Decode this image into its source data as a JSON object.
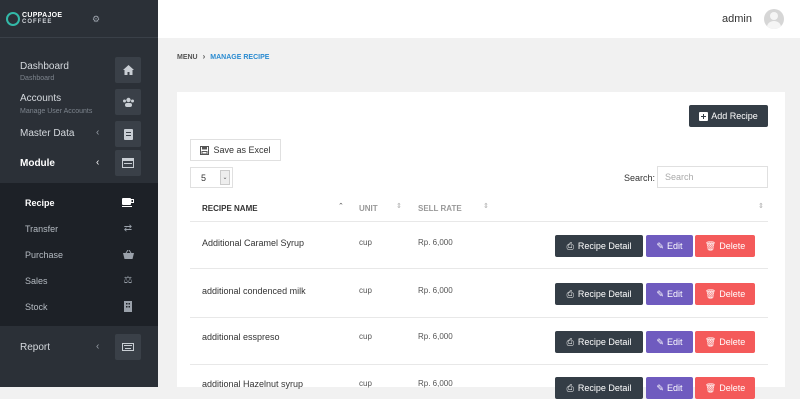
{
  "sidebar": {
    "logo": {
      "name": "CUPPAJOE",
      "sub": "COFFEE"
    },
    "items": [
      {
        "label": "Dashboard",
        "sub": "Dashboard",
        "icon": "home-icon"
      },
      {
        "label": "Accounts",
        "sub": "Manage User Accounts",
        "icon": "users-icon"
      },
      {
        "label": "Master Data",
        "icon": "archive-icon"
      },
      {
        "label": "Module",
        "icon": "window-icon"
      },
      {
        "label": "Report",
        "icon": "keyboard-icon"
      }
    ],
    "module_items": [
      {
        "label": "Recipe",
        "icon": "coffee-icon"
      },
      {
        "label": "Transfer",
        "icon": "exchange-icon"
      },
      {
        "label": "Purchase",
        "icon": "basket-icon"
      },
      {
        "label": "Sales",
        "icon": "balance-scale-icon"
      },
      {
        "label": "Stock",
        "icon": "building-icon"
      }
    ]
  },
  "header": {
    "user": "admin"
  },
  "breadcrumb": {
    "menu": "MENU",
    "separator": "›",
    "current": "MANAGE RECIPE"
  },
  "toolbar": {
    "add_label": "Add Recipe",
    "excel_label": "Save as Excel",
    "page_size": "5",
    "search_label": "Search:",
    "search_placeholder": "Search"
  },
  "table": {
    "columns": [
      "RECIPE NAME",
      "UNIT",
      "SELL RATE"
    ],
    "rows": [
      {
        "name": "Additional Caramel Syrup",
        "unit": "cup",
        "rate": "Rp. 6,000"
      },
      {
        "name": "additional condenced milk",
        "unit": "cup",
        "rate": "Rp. 6,000"
      },
      {
        "name": "additional esspreso",
        "unit": "cup",
        "rate": "Rp. 6,000"
      },
      {
        "name": "additional Hazelnut syrup",
        "unit": "cup",
        "rate": "Rp. 6,000"
      }
    ],
    "actions": {
      "detail": "Recipe Detail",
      "edit": "Edit",
      "delete": "Delete"
    }
  },
  "colors": {
    "sidebar": "#2b3037",
    "accent": "#2a8bd1",
    "edit": "#6f5bbf",
    "delete": "#f45a5a",
    "dark_button": "#343d46"
  }
}
